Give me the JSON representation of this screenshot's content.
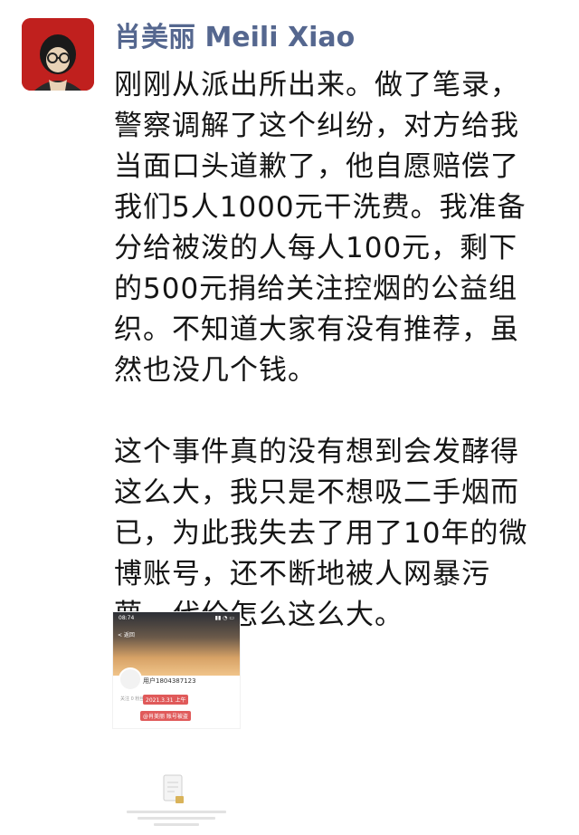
{
  "post": {
    "author": "肖美丽 Meili Xiao",
    "lines": [
      "刚刚从派出所出来。做了笔录，",
      "警察调解了这个纠纷，对方给我",
      "当面口头道歉了，他自愿赔偿了",
      "我们5人1000元干洗费。我准备",
      "分给被泼的人每人100元，剩下",
      "的500元捐给关注控烟的公益组",
      "织。不知道大家有没有推荐，虽",
      "然也没几个钱。"
    ],
    "lines2": [
      "这个事件真的没有想到会发酵得",
      "这么大，我只是不想吸二手烟而",
      "已，为此我失去了用了10年的微",
      "博账号，还不断地被人网暴污",
      "蔑，代价怎么这么大。"
    ]
  },
  "attachment": {
    "status_time": "08:74",
    "back_label": "< 返回",
    "user_label": "用户1804387123",
    "follow_label": "关注 0 粉丝 0",
    "date_badge": "2021.3.31 上午",
    "account_tag": "@肖美丽 账号被盗"
  }
}
